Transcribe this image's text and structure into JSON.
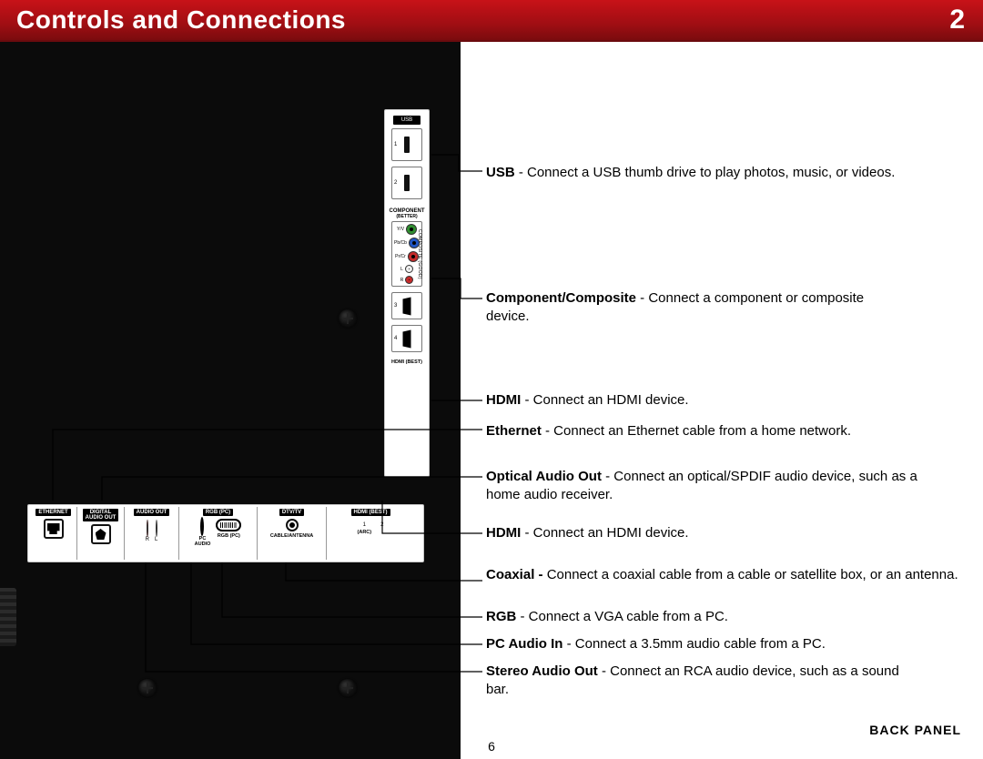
{
  "header": {
    "title": "Controls and Connections",
    "chapter": "2"
  },
  "page_number": "6",
  "footer_label": "BACK PANEL",
  "side_labels": {
    "usb": "USB",
    "component": "COMPONENT",
    "component_sub": "(BETTER)",
    "hdmi_best": "HDMI (BEST)",
    "composite_good": "COMPOSITE (GOOD)"
  },
  "side_port_nums": {
    "usb1": "1",
    "usb2": "2",
    "hdmi3": "3",
    "hdmi4": "4"
  },
  "comp_tags": {
    "yv": "Y/V",
    "pbcb": "Pb/Cb",
    "prcr": "Pr/Cr",
    "l": "L",
    "r": "R"
  },
  "bottom_labels": {
    "ethernet": "ETHERNET",
    "digital_audio_out": "DIGITAL\nAUDIO OUT",
    "audio_out": "AUDIO OUT",
    "rgb_pc": "RGB (PC)",
    "dtv_tv": "DTV/TV",
    "hdmi_best": "HDMI (BEST)",
    "pc_audio": "PC\nAUDIO",
    "rgb_pc_sub": "RGB (PC)",
    "cable_antenna": "CABLE/ANTENNA",
    "arc": "(ARC)",
    "audio_r": "R",
    "audio_l": "L",
    "hdmi1": "1",
    "hdmi2": "2"
  },
  "descriptions": {
    "usb": {
      "bold": "USB",
      "text": " - Connect a USB thumb drive to play photos, music, or videos."
    },
    "component": {
      "bold": "Component/Composite",
      "text": " - Connect a component or composite device."
    },
    "hdmi_side": {
      "bold": "HDMI",
      "text": " - Connect an HDMI device."
    },
    "ethernet": {
      "bold": "Ethernet",
      "text": " - Connect an Ethernet cable from a home network."
    },
    "optical": {
      "bold": "Optical Audio Out",
      "text": " - Connect an optical/SPDIF audio device, such as a home audio receiver."
    },
    "hdmi_bottom": {
      "bold": "HDMI",
      "text": " - Connect an HDMI device."
    },
    "coaxial": {
      "bold": "Coaxial - ",
      "text": "Connect a coaxial cable from a cable or satellite box, or  an antenna."
    },
    "rgb": {
      "bold": "RGB",
      "text": " - Connect a VGA cable from a PC."
    },
    "pcaudio": {
      "bold": "PC Audio In",
      "text": " - Connect a 3.5mm audio cable from a PC."
    },
    "stereo": {
      "bold": "Stereo Audio Out",
      "text": " - Connect an RCA audio device, such as a sound bar."
    }
  }
}
